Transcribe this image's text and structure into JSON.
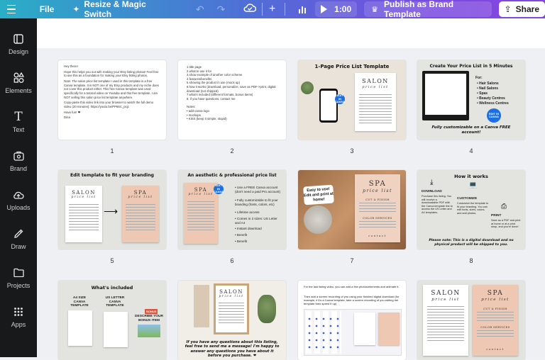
{
  "topbar": {
    "file": "File",
    "resize": "Resize & Magic Switch",
    "timer": "1:00",
    "publish": "Publish as Brand Template",
    "share": "Share"
  },
  "sidebar": {
    "items": [
      {
        "label": "Design",
        "icon": "design-icon"
      },
      {
        "label": "Elements",
        "icon": "elements-icon"
      },
      {
        "label": "Text",
        "icon": "text-icon"
      },
      {
        "label": "Brand",
        "icon": "brand-icon"
      },
      {
        "label": "Uploads",
        "icon": "uploads-icon"
      },
      {
        "label": "Draw",
        "icon": "draw-icon"
      },
      {
        "label": "Projects",
        "icon": "projects-icon"
      },
      {
        "label": "Apps",
        "icon": "apps-icon"
      }
    ]
  },
  "pages": {
    "numbers": [
      "1",
      "2",
      "3",
      "4",
      "5",
      "6",
      "7",
      "8"
    ],
    "p1": {
      "lines": [
        "Hey there!",
        "Hope this helps you out with making your Etsy listing photos! Feel free to use this as a foundation for making your Etsy listing photos.",
        "Note: The salon price list template I used in this template is a free Canva template. It is NOT one of my Etsy products and my niche does not cover this product either. This free Canva template was used specifically for a tutorial video on Youtube and this free template. I am NOT selling this salon price list template anywhere.",
        "Copy-paste this video link into your browser to watch the full demo video (20 minutes): https://youtu.be/PP66C_pcjc",
        "Have fun! ❤",
        "Dina"
      ]
    },
    "p2": {
      "list": [
        "1.title page",
        "2.what to use it for",
        "3.show example of another color scheme",
        "4.features/benefits",
        "5.showing the product in use (mock up)",
        "6.how it works (download, personalize, save as PDF->print, digital download (not shipped)",
        "7.what's included (different formats, bonus items)",
        "8. if you have questions, contact me"
      ],
      "notes_title": "Notes:",
      "notes": [
        "• add canva logo",
        "• mockups",
        "• KISS (keep it simple, stupid)"
      ]
    },
    "p3": {
      "heading": "1-Page Price List Template",
      "salon": "SALON",
      "sub": "price list",
      "badge": "EDIT IN CANVA"
    },
    "p4": {
      "heading": "Create Your Price List in 5 Minutes",
      "for": "For:",
      "items": [
        "• Hair Salons",
        "• Nail Salons",
        "• Spas",
        "• Beauty Centres",
        "• Wellness Centres"
      ],
      "footer": "Fully customizable on a Canva FREE account!",
      "badge": "EDIT IN CANVA"
    },
    "p5": {
      "heading": "Edit template to fit your branding",
      "salon": "SALON",
      "spa": "SPA",
      "sub": "price list"
    },
    "p6": {
      "heading": "An aesthetic & professional price list",
      "items": [
        "• Use a FREE Canva account (don't need a paid Pro account)",
        "• Fully customizable to fit your branding (fonts, colors, etc)",
        "• Lifetime access",
        "• Comes in 2 sizes: US Letter and A4",
        "• Instant download",
        "• Benefit",
        "• Benefit"
      ],
      "spa": "SPA",
      "sub": "price list",
      "badge": "EDIT IN CANVA"
    },
    "p7": {
      "bubble": "Easy to use! Edit and print at home!",
      "spa": "SPA",
      "sub": "price list",
      "cut": "CUT & FINISH",
      "color": "COLOR SERVICES",
      "contact": "contact"
    },
    "p8": {
      "heading": "How it works",
      "download": "DOWNLOAD",
      "download_text": "Purchase this listing. You will receive a downloadable PDF with the Canva template link to access the US Letter and A4 templates.",
      "customize": "CUSTOMIZE",
      "customize_text": "Customize the template to fit your branding. You can edit fonts, sizes, colors, and add photos.",
      "print": "PRINT",
      "print_text": "Save as a PDF and print at home or at a print shop, and you're done!",
      "footer": "Please note: This is a digital download and no physical product will be shipped to you."
    },
    "p9": {
      "heading": "What's included",
      "a4": "A4 SIZE CANVA TEMPLATE",
      "us": "US LETTER CANVA TEMPLATE",
      "bonus_tag": "BONUS",
      "bonus": "DESCRIBE YOUR BONUS ITEM"
    },
    "p10": {
      "text": "If you have any questions about this listing, feel free to send me a message! I'm happy to answer any questions you have about it before you purchase. ❤",
      "salon": "SALON",
      "sub": "price list"
    },
    "p11": {
      "text1": "For the last listing video, you can add a few photos/elements and animate it.",
      "text2": "Then add a screen recording of you using your finished digital download (for example, if it's a Canva template, take a screen recording of you editing the template then speed it up)"
    },
    "p12": {
      "salon": "SALON",
      "spa": "SPA",
      "sub": "price list",
      "cut": "CUT & FINISH",
      "color": "COLOR SERVICES",
      "contact": "contact"
    }
  }
}
